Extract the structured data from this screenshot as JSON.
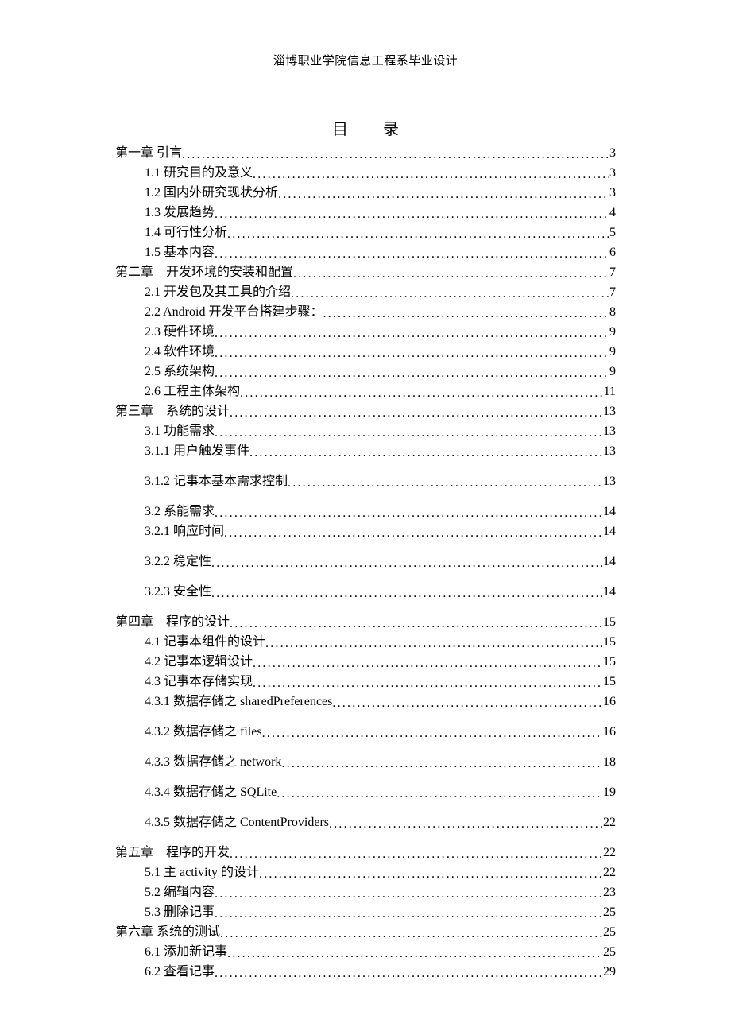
{
  "header": "淄博职业学院信息工程系毕业设计",
  "title": "目　录",
  "toc": [
    {
      "level": 1,
      "label": "第一章 引言",
      "page": "3",
      "gap": false
    },
    {
      "level": 2,
      "label": "1.1 研究目的及意义",
      "page": "3",
      "gap": false
    },
    {
      "level": 2,
      "label": "1.2 国内外研究现状分析 ",
      "page": "3",
      "gap": false
    },
    {
      "level": 2,
      "label": "1.3 发展趋势 ",
      "page": "4",
      "gap": false
    },
    {
      "level": 2,
      "label": "1.4 可行性分析 ",
      "page": "5",
      "gap": false
    },
    {
      "level": 2,
      "label": "1.5 基本内容 ",
      "page": "6",
      "gap": false
    },
    {
      "level": 1,
      "label": "第二章　开发环境的安装和配置",
      "page": "7",
      "gap": false
    },
    {
      "level": 2,
      "label": "2.1 开发包及其工具的介绍",
      "page": "7",
      "gap": false
    },
    {
      "level": 2,
      "label": "2.2 Android 开发平台搭建步骤： ",
      "page": "8",
      "gap": false
    },
    {
      "level": 2,
      "label": "2.3 硬件环境",
      "page": "9",
      "gap": false
    },
    {
      "level": 2,
      "label": "2.4 软件环境",
      "page": "9",
      "gap": false
    },
    {
      "level": 2,
      "label": "2.5 系统架构 ",
      "page": "9",
      "gap": false
    },
    {
      "level": 2,
      "label": "2.6 工程主体架构 ",
      "page": "11",
      "gap": false
    },
    {
      "level": 1,
      "label": "第三章　系统的设计",
      "page": "13",
      "gap": false
    },
    {
      "level": 2,
      "label": "3.1 功能需求",
      "page": "13",
      "gap": false
    },
    {
      "level": 2,
      "label": "3.1.1 用户触发事件",
      "page": "13",
      "gap": true
    },
    {
      "level": 2,
      "label": "3.1.2 记事本基本需求控制",
      "page": "13",
      "gap": true
    },
    {
      "level": 2,
      "label": "3.2 系能需求",
      "page": "14",
      "gap": false
    },
    {
      "level": 2,
      "label": "3.2.1 响应时间",
      "page": "14",
      "gap": true
    },
    {
      "level": 2,
      "label": "3.2.2 稳定性",
      "page": "14",
      "gap": true
    },
    {
      "level": 2,
      "label": "3.2.3 安全性",
      "page": "14",
      "gap": true
    },
    {
      "level": 1,
      "label": "第四章　程序的设计",
      "page": "15",
      "gap": false
    },
    {
      "level": 2,
      "label": "4.1 记事本组件的设计 ",
      "page": "15",
      "gap": false
    },
    {
      "level": 2,
      "label": "4.2 记事本逻辑设计 ",
      "page": "15",
      "gap": false
    },
    {
      "level": 2,
      "label": "4.3 记事本存储实现",
      "page": "15",
      "gap": false
    },
    {
      "level": 2,
      "label": "4.3.1 数据存储之 sharedPreferences ",
      "page": "16",
      "gap": true
    },
    {
      "level": 2,
      "label": "4.3.2 数据存储之 files",
      "page": "16",
      "gap": true
    },
    {
      "level": 2,
      "label": "4.3.3 数据存储之 network ",
      "page": "18",
      "gap": true
    },
    {
      "level": 2,
      "label": "4.3.4 数据存储之 SQLite ",
      "page": "19",
      "gap": true
    },
    {
      "level": 2,
      "label": "4.3.5 数据存储之 ContentProviders",
      "page": "22",
      "gap": true
    },
    {
      "level": 1,
      "label": "第五章　程序的开发",
      "page": "22",
      "gap": false
    },
    {
      "level": 2,
      "label": "5.1 主 activity 的设计",
      "page": "22",
      "gap": false
    },
    {
      "level": 2,
      "label": "5.2 编辑内容",
      "page": "23",
      "gap": false
    },
    {
      "level": 2,
      "label": "5.3 删除记事",
      "page": "25",
      "gap": false
    },
    {
      "level": 1,
      "label": "第六章 系统的测试",
      "page": "25",
      "gap": false
    },
    {
      "level": 2,
      "label": "6.1 添加新记事 ",
      "page": "25",
      "gap": false
    },
    {
      "level": 2,
      "label": "6.2 查看记事 ",
      "page": "29",
      "gap": false
    }
  ]
}
